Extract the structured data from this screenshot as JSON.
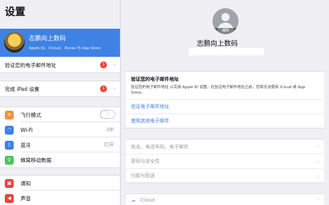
{
  "sidebar": {
    "title": "设置",
    "profile": {
      "name": "志鹏向上数码",
      "subtitle": "Apple ID、iCloud、iTunes 与 App Store"
    },
    "verify_row": {
      "label": "验证您的电子邮件地址",
      "badge": "1"
    },
    "setup_row": {
      "label": "完成 iPad 设置",
      "badge": "1"
    },
    "connectivity": [
      {
        "label": "飞行模式",
        "icon": "airplane-icon",
        "color": "#f0953a"
      },
      {
        "label": "Wi-Fi",
        "icon": "wifi-icon",
        "color": "#3f82e4",
        "value": "jzp"
      },
      {
        "label": "蓝牙",
        "icon": "bluetooth-icon",
        "color": "#3f82e4",
        "value": "打开"
      },
      {
        "label": "蜂窝移动数据",
        "icon": "antenna-icon",
        "color": "#4cc25f"
      }
    ],
    "notifications": [
      {
        "label": "通知",
        "icon": "bell-icon",
        "color": "#e8453c"
      },
      {
        "label": "声音",
        "icon": "speaker-icon",
        "color": "#e8453c"
      }
    ]
  },
  "main": {
    "avatar_edit": "编辑",
    "name": "志鹏向上数码",
    "verify_card": {
      "heading": "验证您的电子邮件地址",
      "description": "验证您的电子邮件地址 以完成 Apple ID 设置。在验证电子邮件地址之前，您将无法使用 iCloud 或 App Store。",
      "link_verify": "验证电子邮件地址",
      "link_other": "使用其他电子邮件"
    },
    "settings_rows": [
      "姓名、电话号码、电子邮件",
      "密码与安全性",
      "付款与配送"
    ],
    "icloud_label": "iCloud"
  },
  "colors": {
    "accent": "#3f82e4",
    "badge": "#e8453c"
  }
}
